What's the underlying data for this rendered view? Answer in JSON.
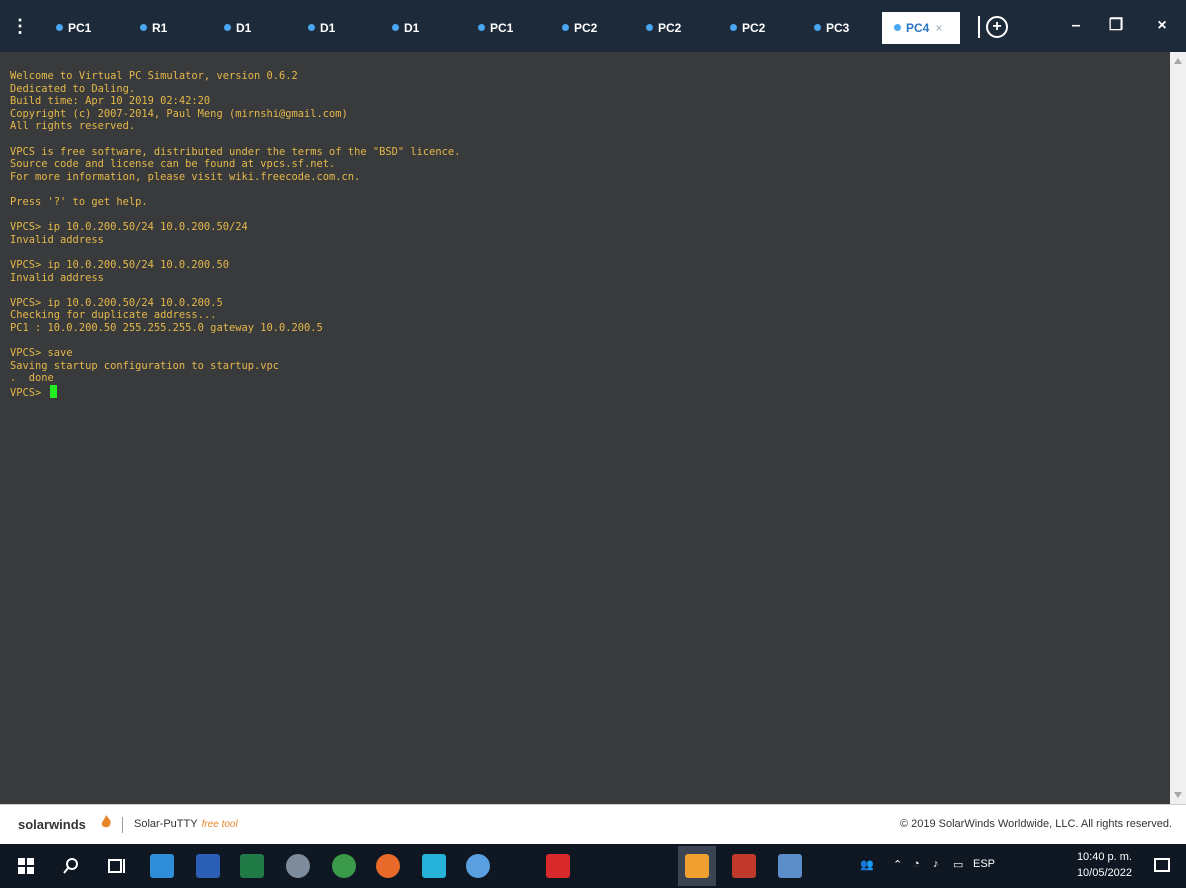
{
  "tabs": [
    {
      "label": "PC1",
      "active": false
    },
    {
      "label": "R1",
      "active": false
    },
    {
      "label": "D1",
      "active": false
    },
    {
      "label": "D1",
      "active": false
    },
    {
      "label": "D1",
      "active": false
    },
    {
      "label": "PC1",
      "active": false
    },
    {
      "label": "PC2",
      "active": false
    },
    {
      "label": "PC2",
      "active": false
    },
    {
      "label": "PC2",
      "active": false
    },
    {
      "label": "PC3",
      "active": false
    },
    {
      "label": "PC4",
      "active": true
    }
  ],
  "tab_close_glyph": "×",
  "new_tab_glyph": "+",
  "window": {
    "minimize": "–",
    "restore": "❐",
    "close": "×"
  },
  "terminal": {
    "lines": "Welcome to Virtual PC Simulator, version 0.6.2\nDedicated to Daling.\nBuild time: Apr 10 2019 02:42:20\nCopyright (c) 2007-2014, Paul Meng (mirnshi@gmail.com)\nAll rights reserved.\n\nVPCS is free software, distributed under the terms of the \"BSD\" licence.\nSource code and license can be found at vpcs.sf.net.\nFor more information, please visit wiki.freecode.com.cn.\n\nPress '?' to get help.\n\nVPCS> ip 10.0.200.50/24 10.0.200.50/24\nInvalid address\n\nVPCS> ip 10.0.200.50/24 10.0.200.50\nInvalid address\n\nVPCS> ip 10.0.200.50/24 10.0.200.5\nChecking for duplicate address...\nPC1 : 10.0.200.50 255.255.255.0 gateway 10.0.200.5\n\nVPCS> save\nSaving startup configuration to startup.vpc\n.  done\n",
    "prompt": "VPCS> "
  },
  "status": {
    "brand": "solarwinds",
    "product": "Solar-PuTTY",
    "free": "free tool",
    "copyright": "© 2019 SolarWinds Worldwide, LLC. All rights reserved."
  },
  "taskbar": {
    "lang": "ESP",
    "time": "10:40 p. m.",
    "date": "10/05/2022"
  },
  "colors": {
    "terminal_text": "#e6b84a",
    "cursor": "#22ee22",
    "tab_dot": "#4aa6f0",
    "brand_orange": "#e8862a"
  }
}
